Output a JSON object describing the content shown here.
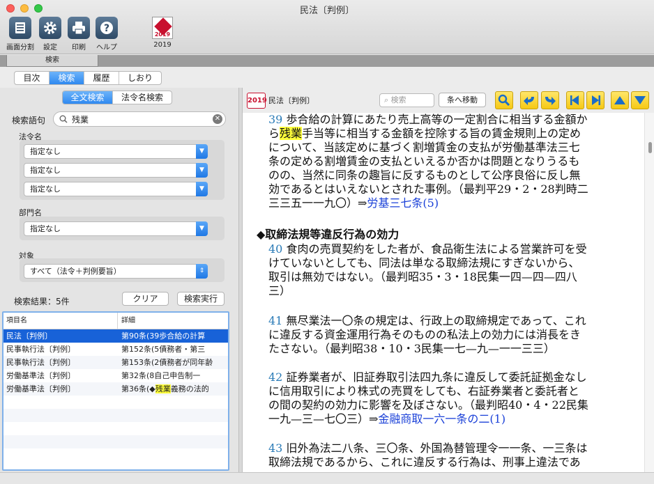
{
  "window": {
    "title": "民法〔判例〕"
  },
  "toolbar": {
    "items": [
      {
        "label": "画面分割",
        "icon": "split-screen-icon"
      },
      {
        "label": "設定",
        "icon": "gear-icon"
      },
      {
        "label": "印刷",
        "icon": "printer-icon"
      },
      {
        "label": "ヘルプ",
        "icon": "help-icon"
      }
    ],
    "book": {
      "label": "2019",
      "badge_text": "2019",
      "icon": "book-cover-icon"
    }
  },
  "search_tab": {
    "label": "検索"
  },
  "nav_tabs": {
    "items": [
      "目次",
      "検索",
      "履歴",
      "しおり"
    ],
    "active": "検索"
  },
  "search_mode": {
    "items": [
      "全文検索",
      "法令名検索"
    ],
    "active": "全文検索"
  },
  "search": {
    "label": "検索語句",
    "query": "残業",
    "law_name_label": "法令名",
    "law_name_selects": [
      "指定なし",
      "指定なし",
      "指定なし"
    ],
    "section_label": "部門名",
    "section_select": "指定なし",
    "target_label": "対象",
    "target_select": "すべて（法令＋判例要旨）",
    "result_count": "検索結果：5件",
    "clear_button": "クリア",
    "run_button": "検索実行"
  },
  "results": {
    "columns": [
      "項目名",
      "詳細"
    ],
    "rows": [
      {
        "name": "民法〔判例〕",
        "detail": "第90条(39歩合給の計算",
        "selected": true
      },
      {
        "name": "民事執行法〔判例〕",
        "detail": "第152条(5債務者・第三"
      },
      {
        "name": "民事執行法〔判例〕",
        "detail": "第153条(2債務者が同年齢"
      },
      {
        "name": "労働基準法〔判例〕",
        "detail": "第32条(8自己申告制一"
      },
      {
        "name": "労働基準法〔判例〕",
        "detail_pre": "第36条(◆",
        "detail_hl": "残業",
        "detail_post": "義務の法的"
      }
    ]
  },
  "right_toolbar": {
    "badge": "2019",
    "title": "民法〔判例〕",
    "search_placeholder": "検索",
    "goto_button": "条へ移動",
    "buttons": [
      "search-icon",
      "back-icon",
      "forward-icon",
      "prev-article-icon",
      "next-article-icon",
      "scroll-up-icon",
      "scroll-down-icon"
    ]
  },
  "content": {
    "p39": {
      "num": "39",
      "l1": "歩合給の計算にあたり売上高等の一定割合に相当する金額か",
      "l2_pre": "ら",
      "l2_hl": "残業",
      "l2_post": "手当等に相当する金額を控除する旨の賃金規則上の定め",
      "l3": "について、当該定めに基づく割増賃金の支払が労働基準法三七",
      "l4": "条の定める割増賃金の支払といえるか否かは問題となりうるも",
      "l5": "のの、当然に同条の趣旨に反するものとして公序良俗に反し無",
      "l6": "効であるとはいえないとされた事例。（最判平29・2・28判時二",
      "l7_pre": "三三五一一九〇）⇒",
      "l7_link": "労基三七条(5)"
    },
    "heading": "◆取締法規等違反行為の効力",
    "p40": {
      "num": "40",
      "l1": "食肉の売買契約をした者が、食品衛生法による営業許可を受",
      "l2": "けていないとしても、同法は単なる取締法規にすぎないから、",
      "l3": "取引は無効ではない。（最判昭35・3・18民集一四—四—四八",
      "l4": "三）"
    },
    "p41": {
      "num": "41",
      "l1": "無尽業法一〇条の規定は、行政上の取締規定であって、これ",
      "l2": "に違反する資金運用行為そのものの私法上の効力には消長をき",
      "l3": "たさない。（最判昭38・10・3民集一七—九—一一三三）"
    },
    "p42": {
      "num": "42",
      "l1": "証券業者が、旧証券取引法四九条に違反して委託証拠金なし",
      "l2": "に信用取引により株式の売買をしても、右証券業者と委託者と",
      "l3": "の間の契約の効力に影響を及ぼさない。（最判昭40・4・22民集",
      "l4_pre": "一九—三—七〇三）⇒",
      "l4_link": "金融商取一六一条の二(1)"
    },
    "p43": {
      "num": "43",
      "l1": "旧外為法二八条、三〇条、外国為替管理令一一条、一三条は",
      "l2": "取締法規であるから、これに違反する行為は、刑事上違法であ"
    }
  },
  "colors": {
    "accent": "#2f89f0",
    "selection": "#1862d8",
    "highlight": "#ffff3a",
    "article_number": "#2a7bb7",
    "link": "#1a40d8",
    "nav_button": "#f6c814"
  }
}
